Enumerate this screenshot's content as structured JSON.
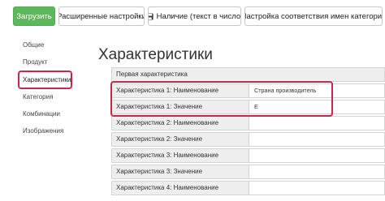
{
  "toolbar": {
    "upload_label": "Загрузить",
    "advanced_label": "Расширенные настройки",
    "stock_label": "Наличие (текст в число)",
    "category_mapping_label": "Настройка соответствия имен категорий"
  },
  "sidebar": {
    "items": [
      {
        "label": "Общие"
      },
      {
        "label": "Продукт"
      },
      {
        "label": "Характеристики"
      },
      {
        "label": "Категория"
      },
      {
        "label": "Комбинации"
      },
      {
        "label": "Изображения"
      }
    ]
  },
  "main": {
    "title": "Характеристики",
    "rows": [
      {
        "label": "Первая характеристика",
        "value": ""
      },
      {
        "label": "Характеристика 1: Наименование",
        "value": "Страна производитель"
      },
      {
        "label": "Характеристика 1: Значение",
        "value": "E"
      },
      {
        "label": "Характеристика 2: Наименование",
        "value": ""
      },
      {
        "label": "Характеристика 2: Значение",
        "value": ""
      },
      {
        "label": "Характеристика 3: Наименование",
        "value": ""
      },
      {
        "label": "Характеристика 3: Значение",
        "value": ""
      },
      {
        "label": "Характеристика 4: Наименование",
        "value": ""
      }
    ]
  },
  "colors": {
    "primary": "#5cb85c",
    "highlight": "#c4284a",
    "label_bg": "#eeeeee"
  },
  "icons": {
    "stock_button_icon": "floppy-disk-icon"
  }
}
